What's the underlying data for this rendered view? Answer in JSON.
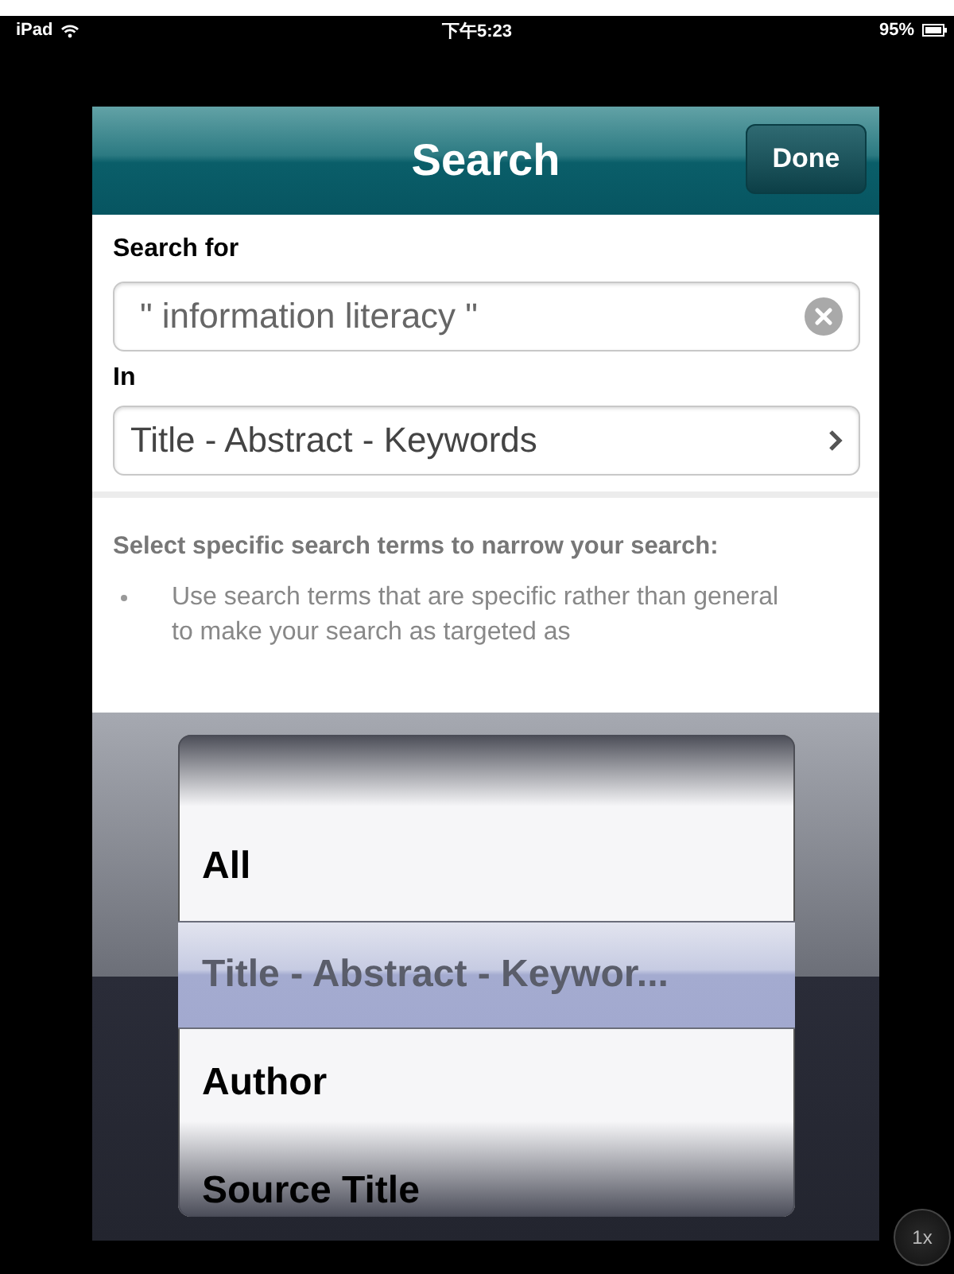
{
  "status_bar": {
    "device": "iPad",
    "time": "下午5:23",
    "battery": "95%"
  },
  "nav_bar": {
    "title": "Search",
    "done_button": "Done"
  },
  "search_field": {
    "label": "Search for",
    "value": "\" information literacy \""
  },
  "in_field": {
    "label": "In",
    "value": "Title - Abstract - Keywords"
  },
  "help": {
    "heading": "Select specific search terms to narrow your search:",
    "bullets": [
      "Use search terms that are specific rather than general to make your search as targeted as"
    ]
  },
  "picker": {
    "items": [
      {
        "label": "All",
        "selected": false
      },
      {
        "label": "Title - Abstract - Keywor...",
        "selected": true
      },
      {
        "label": "Author",
        "selected": false
      },
      {
        "label": "Source Title",
        "selected": false
      }
    ]
  },
  "zoom_button": "1x"
}
